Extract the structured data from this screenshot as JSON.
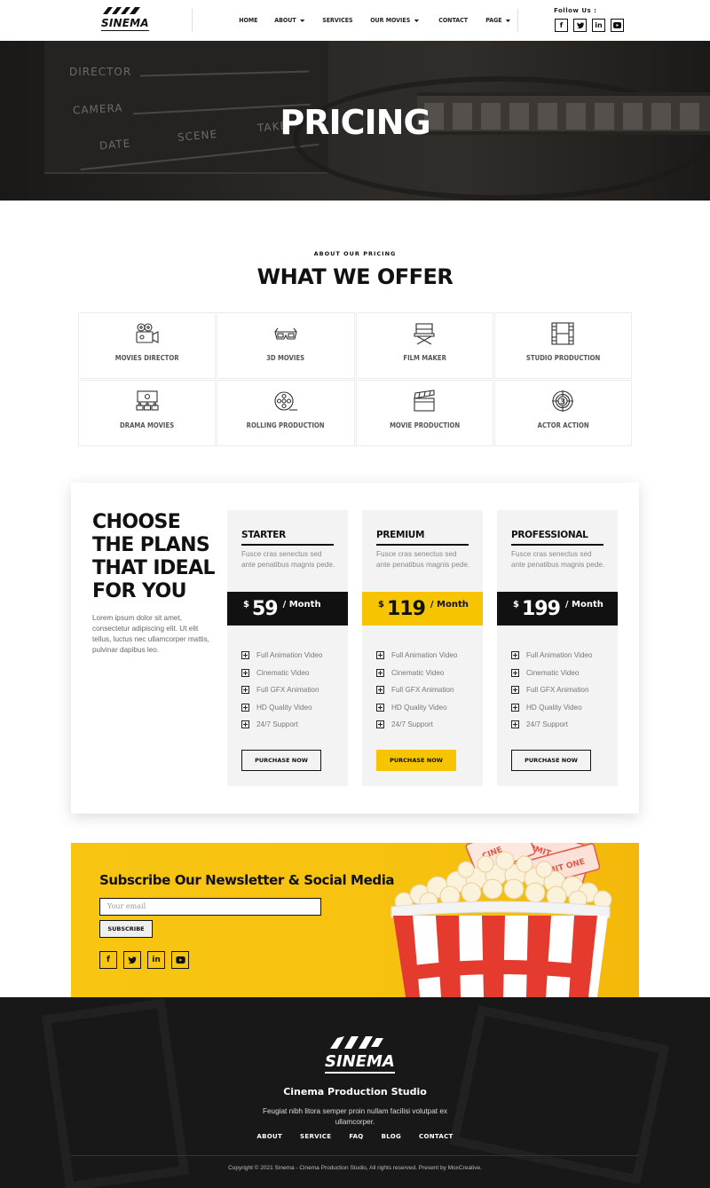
{
  "header": {
    "logo_text": "SINEMA",
    "nav": [
      {
        "label": "HOME",
        "dropdown": false
      },
      {
        "label": "ABOUT",
        "dropdown": true
      },
      {
        "label": "SERVICES",
        "dropdown": false
      },
      {
        "label": "OUR MOVIES",
        "dropdown": true
      },
      {
        "label": "CONTACT",
        "dropdown": false
      },
      {
        "label": "PAGE",
        "dropdown": true
      }
    ],
    "follow_label": "Follow Us :",
    "social_icons": [
      "facebook-icon",
      "twitter-icon",
      "linkedin-icon",
      "youtube-icon"
    ]
  },
  "hero": {
    "title": "PRICING",
    "board_labels": [
      "DIRECTOR",
      "CAMERA",
      "DATE",
      "SCENE",
      "TAKE"
    ]
  },
  "offer": {
    "kicker": "ABOUT OUR PRICING",
    "title": "WHAT WE OFFER",
    "items": [
      {
        "label": "MOVIES DIRECTOR",
        "icon": "film-camera-icon"
      },
      {
        "label": "3D MOVIES",
        "icon": "3d-glasses-icon"
      },
      {
        "label": "FILM MAKER",
        "icon": "director-chair-icon"
      },
      {
        "label": "STUDIO PRODUCTION",
        "icon": "film-strip-icon"
      },
      {
        "label": "DRAMA MOVIES",
        "icon": "cinema-screen-icon"
      },
      {
        "label": "ROLLING PRODUCTION",
        "icon": "film-reel-icon"
      },
      {
        "label": "MOVIE PRODUCTION",
        "icon": "clapperboard-icon"
      },
      {
        "label": "ACTOR ACTION",
        "icon": "countdown-icon"
      }
    ]
  },
  "pricing": {
    "heading": "CHOOSE THE PLANS THAT IDEAL FOR YOU",
    "description": "Lorem ipsum dolor sit amet, consectetur adipiscing elit. Ut elit tellus, luctus nec ullamcorper mattis, pulvinar dapibus leo.",
    "plans": [
      {
        "name": "STARTER",
        "desc": "Fusce cras senectus sed ante penatibus magnis pede.",
        "currency": "$",
        "price": "59",
        "period": "/ Month",
        "highlight": false,
        "features": [
          "Full Animation Video",
          "Cinematic Video",
          "Full GFX Animation",
          "HD Quality Video",
          "24/7 Support"
        ],
        "button": "PURCHASE NOW"
      },
      {
        "name": "PREMIUM",
        "desc": "Fusce cras senectus sed ante penatibus magnis pede.",
        "currency": "$",
        "price": "119",
        "period": "/ Month",
        "highlight": true,
        "features": [
          "Full Animation Video",
          "Cinematic Video",
          "Full GFX Animation",
          "HD Quality Video",
          "24/7 Support"
        ],
        "button": "PURCHASE NOW"
      },
      {
        "name": "PROFESSIONAL",
        "desc": "Fusce cras senectus sed ante penatibus magnis pede.",
        "currency": "$",
        "price": "199",
        "period": "/ Month",
        "highlight": false,
        "features": [
          "Full Animation Video",
          "Cinematic Video",
          "Full GFX Animation",
          "HD Quality Video",
          "24/7 Support"
        ],
        "button": "PURCHASE NOW"
      }
    ]
  },
  "newsletter": {
    "title": "Subscribe Our Newsletter & Social Media",
    "placeholder": "Your email",
    "button": "SUBSCRIBE",
    "ticket_text": [
      "CINE",
      "ADMIT O",
      "ADMIT ONE"
    ]
  },
  "footer": {
    "logo_text": "SINEMA",
    "title": "Cinema Production Studio",
    "description": "Feugiat nibh litora semper proin nullam facilisi volutpat ex ullamcorper.",
    "links": [
      "ABOUT",
      "SERVICE",
      "FAQ",
      "BLOG",
      "CONTACT"
    ],
    "copyright": "Copyright © 2021 Sinema - Cinema Production Studio, All rights reserved. Present by MoxCreative."
  },
  "colors": {
    "accent": "#f6c400",
    "dark": "#111111",
    "footer_bg": "#181818"
  }
}
